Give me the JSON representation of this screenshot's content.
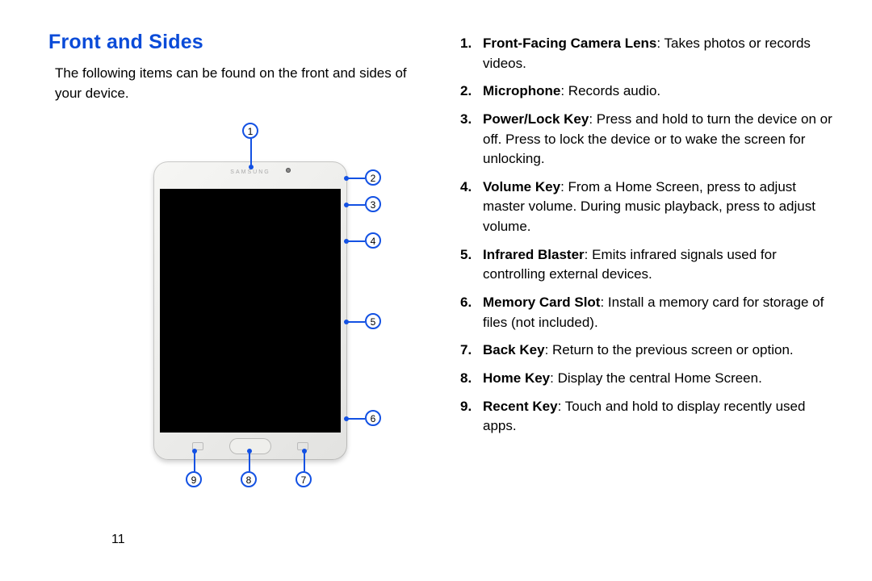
{
  "heading": "Front and Sides",
  "intro": "The following items can be found on the front and sides of your device.",
  "brand": "SAMSUNG",
  "page_number": "11",
  "callouts": {
    "c1": "1",
    "c2": "2",
    "c3": "3",
    "c4": "4",
    "c5": "5",
    "c6": "6",
    "c7": "7",
    "c8": "8",
    "c9": "9"
  },
  "items": [
    {
      "n": "1.",
      "term": "Front-Facing Camera Lens",
      "desc": ": Takes photos or records videos."
    },
    {
      "n": "2.",
      "term": "Microphone",
      "desc": ": Records audio."
    },
    {
      "n": "3.",
      "term": "Power/Lock Key",
      "desc": ": Press and hold to turn the device on or off. Press to lock the device or to wake the screen for unlocking."
    },
    {
      "n": "4.",
      "term": "Volume Key",
      "desc": ": From a Home Screen, press to adjust master volume. During music playback, press to adjust volume."
    },
    {
      "n": "5.",
      "term": "Infrared Blaster",
      "desc": ": Emits infrared signals used for controlling external devices."
    },
    {
      "n": "6.",
      "term": "Memory Card Slot",
      "desc": ": Install a memory card for storage of files (not included)."
    },
    {
      "n": "7.",
      "term": "Back Key",
      "desc": ": Return to the previous screen or option."
    },
    {
      "n": "8.",
      "term": "Home Key",
      "desc": ": Display the central Home Screen."
    },
    {
      "n": "9.",
      "term": "Recent Key",
      "desc": ": Touch and hold to display recently used apps."
    }
  ]
}
